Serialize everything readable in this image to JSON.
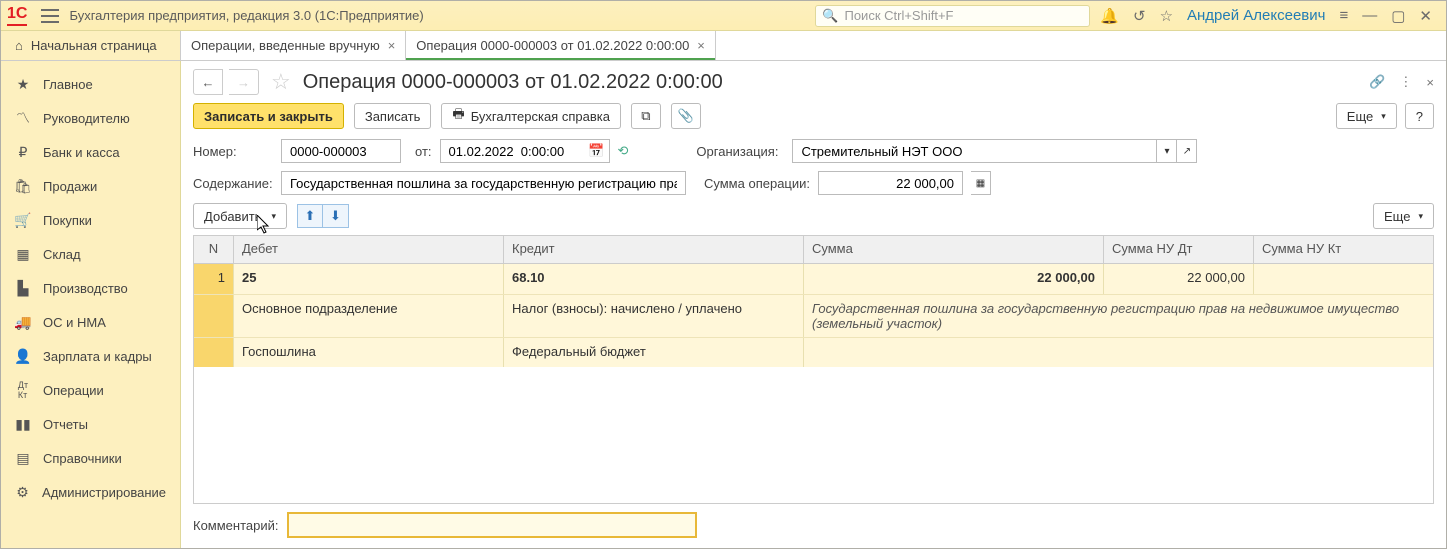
{
  "app_title": "Бухгалтерия предприятия, редакция 3.0  (1С:Предприятие)",
  "search_placeholder": "Поиск Ctrl+Shift+F",
  "user_name": "Андрей Алексеевич",
  "tabs": {
    "home": "Начальная страница",
    "t1": "Операции, введенные вручную",
    "t2": "Операция 0000-000003 от 01.02.2022 0:00:00"
  },
  "sidebar": [
    {
      "icon": "★",
      "label": "Главное"
    },
    {
      "icon": "📈",
      "label": "Руководителю"
    },
    {
      "icon": "₽",
      "label": "Банк и касса"
    },
    {
      "icon": "🛍",
      "label": "Продажи"
    },
    {
      "icon": "🛒",
      "label": "Покупки"
    },
    {
      "icon": "📦",
      "label": "Склад"
    },
    {
      "icon": "🏭",
      "label": "Производство"
    },
    {
      "icon": "🚚",
      "label": "ОС и НМА"
    },
    {
      "icon": "👤",
      "label": "Зарплата и кадры"
    },
    {
      "icon": "Дт",
      "label": "Операции"
    },
    {
      "icon": "📊",
      "label": "Отчеты"
    },
    {
      "icon": "📚",
      "label": "Справочники"
    },
    {
      "icon": "⚙",
      "label": "Администрирование"
    }
  ],
  "page_title": "Операция 0000-000003 от 01.02.2022 0:00:00",
  "toolbar": {
    "save_close": "Записать и закрыть",
    "save": "Записать",
    "print_ref": "Бухгалтерская справка",
    "more": "Еще",
    "help": "?"
  },
  "form": {
    "number_label": "Номер:",
    "number_value": "0000-000003",
    "from_label": "от:",
    "date_value": "01.02.2022  0:00:00",
    "org_label": "Организация:",
    "org_value": "Стремительный НЭТ ООО",
    "content_label": "Содержание:",
    "content_value": "Государственная пошлина за государственную регистрацию прав",
    "sum_label": "Сумма операции:",
    "sum_value": "22 000,00",
    "add_button": "Добавить",
    "more2": "Еще",
    "comment_label": "Комментарий:"
  },
  "grid": {
    "headers": {
      "n": "N",
      "debit": "Дебет",
      "credit": "Кредит",
      "sum": "Сумма",
      "nudt": "Сумма НУ Дт",
      "nukt": "Сумма НУ Кт"
    },
    "row": {
      "n": "1",
      "debit_acc": "25",
      "credit_acc": "68.10",
      "sum": "22 000,00",
      "nudt": "22 000,00",
      "debit_sub1": "Основное подразделение",
      "credit_sub1": "Налог (взносы): начислено / уплачено",
      "desc": "Государственная пошлина за государственную регистрацию прав на недвижимое имущество (земельный участок)",
      "debit_sub2": "Госпошлина",
      "credit_sub2": "Федеральный бюджет"
    }
  }
}
